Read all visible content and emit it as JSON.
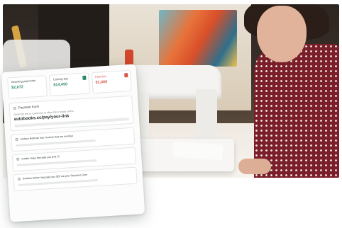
{
  "colors": {
    "accent_green": "#2e8a6a",
    "overdue_red": "#d9544a",
    "card_bg": "#fbfcfb"
  },
  "stats": [
    {
      "label": "Incoming payments",
      "value": "$2,672",
      "flag_color": ""
    },
    {
      "label": "Coming due",
      "value": "$14,450",
      "flag_color": "#2e8a6a"
    },
    {
      "label": "Past due",
      "value": "$1,000",
      "flag_color": "#d9544a"
    }
  ],
  "payment_form": {
    "title": "Payment Form",
    "description": "Send this link to customers to allow them to pay online.",
    "link": "autobooks.cc/pay/your-link"
  },
  "activity": [
    {
      "text": "Andrew Hoffman has invoices that are overdue"
    },
    {
      "text": "Amalie Hope has paid you $75.72"
    },
    {
      "text": "Graham Robert has paid you $20 via your Payment Form"
    }
  ]
}
